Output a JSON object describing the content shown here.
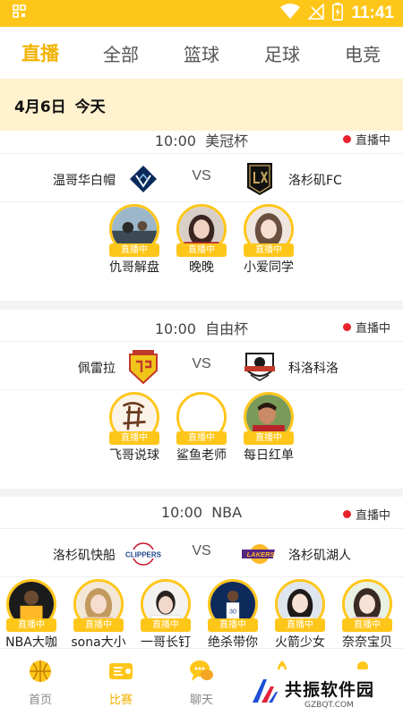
{
  "status_bar": {
    "time": "11:41"
  },
  "tabs": [
    {
      "label": "直播",
      "active": true
    },
    {
      "label": "全部"
    },
    {
      "label": "篮球"
    },
    {
      "label": "足球"
    },
    {
      "label": "电竞"
    }
  ],
  "date_bar": {
    "date": "4月6日",
    "day": "今天"
  },
  "matches": [
    {
      "time": "10:00",
      "league": "美冠杯",
      "status": "直播中",
      "home": {
        "name": "温哥华白帽"
      },
      "vs": "VS",
      "away": {
        "name": "洛杉矶FC"
      },
      "anchors": [
        {
          "name": "仇哥解盘",
          "badge": "直播中"
        },
        {
          "name": "晚晚",
          "badge": "直播中"
        },
        {
          "name": "小爱同学",
          "badge": "直播中"
        }
      ]
    },
    {
      "time": "10:00",
      "league": "自由杯",
      "status": "直播中",
      "home": {
        "name": "佩雷拉"
      },
      "vs": "VS",
      "away": {
        "name": "科洛科洛"
      },
      "anchors": [
        {
          "name": "飞哥说球",
          "badge": "直播中"
        },
        {
          "name": "鲨鱼老师",
          "badge": "直播中"
        },
        {
          "name": "每日红单",
          "badge": "直播中"
        }
      ]
    },
    {
      "time": "10:00",
      "league": "NBA",
      "status": "直播中",
      "home": {
        "name": "洛杉矶快船",
        "logo_text": "CLIPPERS"
      },
      "vs": "VS",
      "away": {
        "name": "洛杉矶湖人",
        "logo_text": "LAKERS"
      },
      "anchors": [
        {
          "name": "NBA大咖",
          "badge": "直播中"
        },
        {
          "name": "sona大小",
          "badge": "直播中"
        },
        {
          "name": "一哥长钉",
          "badge": "直播中"
        },
        {
          "name": "绝杀带你",
          "badge": "直播中"
        },
        {
          "name": "火箭少女",
          "badge": "直播中"
        },
        {
          "name": "奈奈宝贝",
          "badge": "直播中"
        }
      ]
    }
  ],
  "bottom_nav": [
    {
      "label": "首页",
      "icon": "basketball-icon"
    },
    {
      "label": "比赛",
      "icon": "ticket-icon",
      "active": true
    },
    {
      "label": "聊天",
      "icon": "chat-icon"
    },
    {
      "label": "",
      "icon": "rocket-icon"
    },
    {
      "label": "",
      "icon": "person-icon"
    }
  ],
  "watermark": {
    "title": "共振软件园",
    "url": "GZBQT.COM"
  },
  "colors": {
    "accent": "#ffc61a",
    "accent_text": "#f2b300",
    "live_dot": "#e8232d",
    "date_bg": "#fff2ce"
  }
}
